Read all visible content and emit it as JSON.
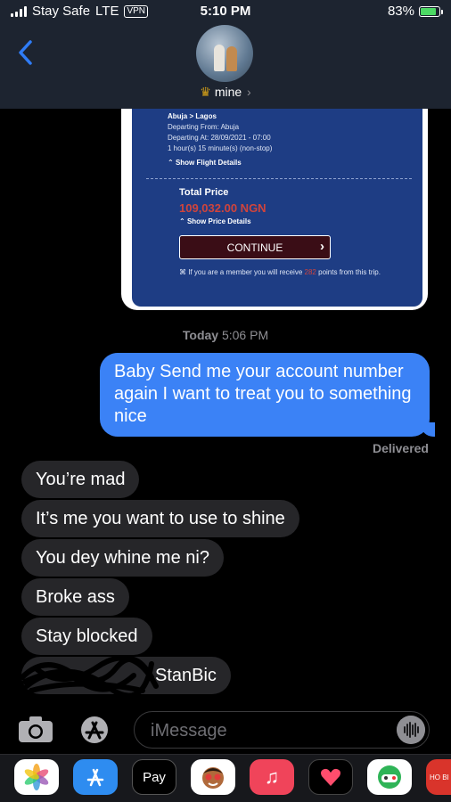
{
  "status_bar": {
    "carrier": "Stay Safe",
    "network": "LTE",
    "vpn": "VPN",
    "time": "5:10 PM",
    "battery": "83%",
    "battery_level": 0.83
  },
  "header": {
    "contact_name": "mine",
    "crown_icon": "crown-emoji",
    "back_icon": "chevron-left-icon"
  },
  "shared_screenshot": {
    "route": "Abuja > Lagos",
    "departing_from": "Departing From: Abuja",
    "departing_at": "Departing At: 28/09/2021 - 07:00",
    "duration": "1 hour(s) 15 minute(s) (non-stop)",
    "show_flight_details": "Show Flight Details",
    "total_price_label": "Total Price",
    "total_price": "109,032.00 NGN",
    "show_price_details": "Show Price Details",
    "continue_label": "CONTINUE",
    "member_note_prefix": "If you are a member you will receive",
    "member_points": "282",
    "member_note_suffix": "points from this trip."
  },
  "timestamp": {
    "day": "Today",
    "time": "5:06 PM"
  },
  "messages": {
    "sent": "Baby Send me your account number again I want to treat you to something nice",
    "delivered": "Delivered",
    "received": [
      "You’re mad",
      "It’s me you want to use to shine",
      "You dey whine me ni?",
      "Broke ass",
      "Stay blocked",
      "StanBic"
    ]
  },
  "composer": {
    "placeholder": "iMessage"
  },
  "app_drawer": {
    "apps": [
      "Photos",
      "App Store",
      "Pay",
      "Memoji",
      "Music",
      "Digital Touch",
      "Game Pigeon",
      "HO BI"
    ],
    "apple_pay_label": "Pay",
    "partial_app_label": "HO BI"
  },
  "colors": {
    "sent_bubble": "#3b82f6",
    "received_bubble": "#262629",
    "card_bg": "#1e3d84",
    "price_red": "#d0443c"
  }
}
